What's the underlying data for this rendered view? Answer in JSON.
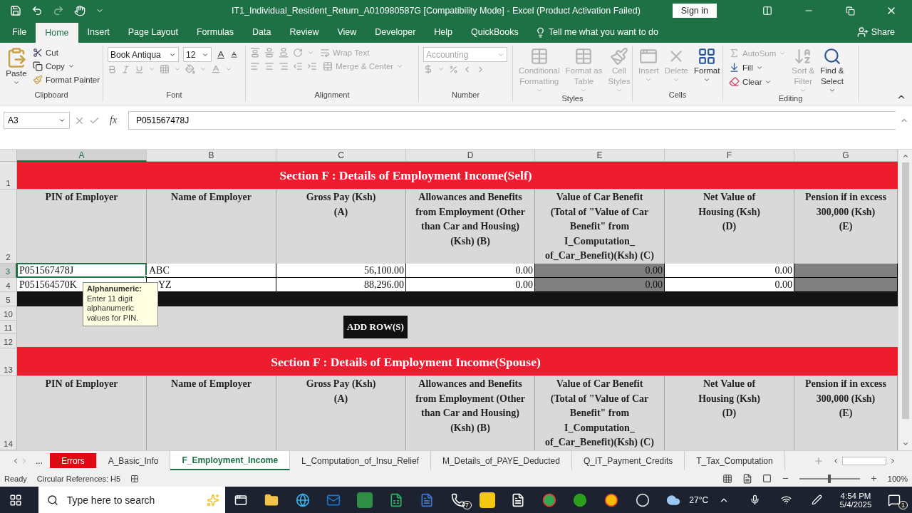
{
  "title_bar": {
    "title": "IT1_Individual_Resident_Return_A010980587G  [Compatibility Mode]  -  Excel (Product Activation Failed)",
    "sign_in": "Sign in"
  },
  "menu_tabs": [
    {
      "label": "File",
      "selected": false
    },
    {
      "label": "Home",
      "selected": true
    },
    {
      "label": "Insert",
      "selected": false
    },
    {
      "label": "Page Layout",
      "selected": false
    },
    {
      "label": "Formulas",
      "selected": false
    },
    {
      "label": "Data",
      "selected": false
    },
    {
      "label": "Review",
      "selected": false
    },
    {
      "label": "View",
      "selected": false
    },
    {
      "label": "Developer",
      "selected": false
    },
    {
      "label": "Help",
      "selected": false
    },
    {
      "label": "QuickBooks",
      "selected": false
    }
  ],
  "tell_me": "Tell me what you want to do",
  "share": "Share",
  "ribbon": [
    {
      "kind": "clipboard",
      "label": "Clipboard",
      "paste": "Paste",
      "cut": "Cut",
      "copy": "Copy",
      "format_painter": "Format Painter"
    },
    {
      "kind": "font",
      "label": "Font",
      "font_name": "Book Antiqua",
      "font_size": "12"
    },
    {
      "kind": "alignment",
      "label": "Alignment",
      "wrap_text": "Wrap Text",
      "merge": "Merge & Center",
      "disabled": true
    },
    {
      "kind": "number",
      "label": "Number",
      "format": "Accounting",
      "disabled": true
    },
    {
      "kind": "styles",
      "label": "Styles",
      "buttons": [
        {
          "label": "Conditional\nFormatting",
          "disabled": true
        },
        {
          "label": "Format as\nTable",
          "disabled": true
        },
        {
          "label": "Cell\nStyles",
          "disabled": true
        }
      ]
    },
    {
      "kind": "cells",
      "label": "Cells",
      "buttons": [
        {
          "label": "Insert",
          "disabled": true
        },
        {
          "label": "Delete",
          "disabled": true
        },
        {
          "label": "Format",
          "disabled": false
        }
      ]
    },
    {
      "kind": "editing",
      "label": "Editing",
      "small": [
        {
          "label": "AutoSum",
          "disabled": true
        },
        {
          "label": "Fill",
          "disabled": false
        },
        {
          "label": "Clear",
          "disabled": false
        }
      ],
      "buttons": [
        {
          "label": "Sort &\nFilter",
          "disabled": true
        },
        {
          "label": "Find &\nSelect",
          "disabled": false
        }
      ]
    }
  ],
  "formula_bar": {
    "name_box": "A3",
    "function_label": "fx",
    "formula": "P051567478J"
  },
  "columns": [
    {
      "label": "A",
      "selected": true
    },
    {
      "label": "B",
      "selected": false
    },
    {
      "label": "C",
      "selected": false
    },
    {
      "label": "D",
      "selected": false
    },
    {
      "label": "E",
      "selected": false
    },
    {
      "label": "F",
      "selected": false
    },
    {
      "label": "G",
      "selected": false
    }
  ],
  "rows": [
    {
      "kind": "section",
      "numbers": [
        "1"
      ],
      "selected": false,
      "text": "Section F : Details of Employment Income(Self)"
    },
    {
      "kind": "header",
      "numbers": [
        "2"
      ],
      "selected": false,
      "cells": [
        "PIN of Employer",
        "Name of Employer",
        "Gross Pay (Ksh)\n(A)",
        "Allowances and Benefits\nfrom Employment (Other\nthan Car and Housing)\n(Ksh) (B)",
        "Value of Car Benefit\n(Total of \"Value of Car\nBenefit\" from\nI_Computation_\nof_Car_Benefit)(Ksh) (C)",
        "Net Value of\nHousing (Ksh)\n(D)",
        "Pension if in excess\n300,000 (Ksh)\n(E)"
      ]
    },
    {
      "kind": "data",
      "numbers": [
        "3"
      ],
      "selected": true,
      "cells": [
        {
          "text": "P051567478J",
          "shaded": false
        },
        {
          "text": "ABC",
          "shaded": false
        },
        {
          "text": "56,100.00",
          "shaded": false
        },
        {
          "text": "0.00",
          "shaded": false
        },
        {
          "text": "0.00",
          "shaded": true
        },
        {
          "text": "0.00",
          "shaded": false
        },
        {
          "shaded": true
        }
      ]
    },
    {
      "kind": "data",
      "numbers": [
        "4"
      ],
      "selected": false,
      "cells": [
        {
          "text": "P051564570K",
          "shaded": false
        },
        {
          "text": "YZ",
          "shaded": false
        },
        {
          "text": "88,296.00",
          "shaded": false
        },
        {
          "text": "0.00",
          "shaded": false
        },
        {
          "text": "0.00",
          "shaded": true
        },
        {
          "text": "0.00",
          "shaded": false
        },
        {
          "shaded": true
        }
      ]
    },
    {
      "kind": "divider",
      "numbers": [
        "5"
      ],
      "selected": false
    },
    {
      "kind": "action",
      "numbers": [
        "10",
        "11",
        "12"
      ],
      "selected": false,
      "button": "ADD ROW(S)"
    },
    {
      "kind": "section",
      "numbers": [
        "13"
      ],
      "selected": false,
      "text": "Section F : Details of Employment Income(Spouse)"
    },
    {
      "kind": "header",
      "numbers": [
        "14"
      ],
      "selected": false,
      "cells": [
        "PIN of Employer",
        "Name of Employer",
        "Gross Pay (Ksh)\n(A)",
        "Allowances and Benefits\nfrom Employment (Other\nthan Car and Housing)\n(Ksh) (B)",
        "Value of Car Benefit\n(Total of \"Value of Car\nBenefit\" from\nI_Computation_\nof_Car_Benefit)(Ksh) (C)",
        "Net Value of\nHousing (Ksh)\n(D)",
        "Pension if in excess\n300,000 (Ksh)\n(E)"
      ]
    }
  ],
  "tooltip": {
    "title": "Alphanumeric:",
    "body": "Enter 11 digit alphanumeric values for PIN."
  },
  "sheet_tabs": {
    "more": "...",
    "tabs": [
      {
        "label": "Errors",
        "selected": false,
        "color": "#e30613"
      },
      {
        "label": "A_Basic_Info",
        "selected": false
      },
      {
        "label": "F_Employment_Income",
        "selected": true
      },
      {
        "label": "L_Computation_of_Insu_Relief",
        "selected": false
      },
      {
        "label": "M_Details_of_PAYE_Deducted",
        "selected": false
      },
      {
        "label": "Q_IT_Payment_Credits",
        "selected": false
      },
      {
        "label": "T_Tax_Computation",
        "selected": false
      }
    ]
  },
  "status_bar": {
    "ready": "Ready",
    "circular": "Circular References: H5",
    "zoom": {
      "level": 0.5,
      "reading": "100%"
    }
  },
  "taskbar": {
    "search_placeholder": "Type here to search",
    "whatsapp_badge": "7",
    "weather": "27°C",
    "time": "4:54 PM",
    "date": "5/4/2025",
    "notifications": "1"
  }
}
